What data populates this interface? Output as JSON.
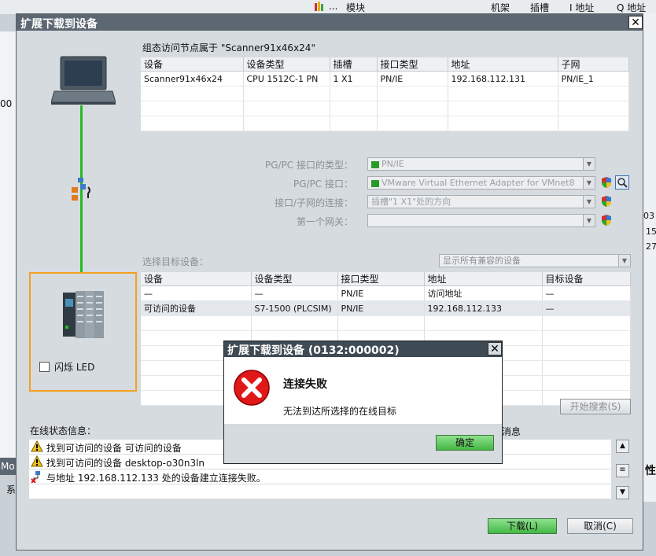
{
  "background": {
    "columns": [
      "模块",
      "机架",
      "插槽",
      "I 地址",
      "Q 地址"
    ],
    "dots": "...",
    "left_numbers": [
      "00",
      "Mo",
      "系"
    ],
    "right_numbers": [
      "03",
      "15",
      "27"
    ],
    "right_side_text": "性",
    "right_side_text2": "消息"
  },
  "dialog": {
    "title": "扩展下载到设备",
    "config_label": "组态访问节点属于 \"Scanner91x46x24\"",
    "config_table": {
      "headers": [
        "设备",
        "设备类型",
        "插槽",
        "接口类型",
        "地址",
        "子网"
      ],
      "rows": [
        [
          "Scanner91x46x24",
          "CPU 1512C-1 PN",
          "1 X1",
          "PN/IE",
          "192.168.112.131",
          "PN/IE_1"
        ]
      ]
    },
    "fields": [
      {
        "label": "PG/PC 接口的类型：",
        "value": "PN/IE"
      },
      {
        "label": "PG/PC 接口：",
        "value": "VMware Virtual Ethernet Adapter for VMnet8"
      },
      {
        "label": "接口/子网的连接：",
        "value": "插槽\"1 X1\"处的方向"
      },
      {
        "label": "第一个网关：",
        "value": ""
      }
    ],
    "target_label": "选择目标设备：",
    "target_filter": "显示所有兼容的设备",
    "target_table": {
      "headers": [
        "设备",
        "设备类型",
        "接口类型",
        "地址",
        "目标设备"
      ],
      "rows": [
        [
          "—",
          "—",
          "PN/IE",
          "访问地址",
          "—"
        ],
        [
          "可访问的设备",
          "S7-1500 (PLCSIM)",
          "PN/IE",
          "192.168.112.133",
          "—"
        ]
      ]
    },
    "flash_led": "闪烁 LED",
    "start_search": "开始搜索(S)",
    "status_label": "在线状态信息：",
    "status_lines": [
      "找到可访问的设备 可访问的设备",
      "找到可访问的设备 desktop-o30n3ln",
      "与地址 192.168.112.133 处的设备建立连接失败。"
    ],
    "download_btn": "下载(L)",
    "cancel_btn": "取消(C)",
    "close": "✕"
  },
  "popup": {
    "title": "扩展下载到设备 (0132:000002)",
    "heading": "连接失败",
    "message": "无法到达所选择的在线目标",
    "ok": "确定",
    "close": "✕"
  },
  "colors": {
    "title_bar": "#5c6771",
    "link_line": "#22bb22",
    "highlight_border": "#f4a020",
    "error_red": "#e01818"
  }
}
